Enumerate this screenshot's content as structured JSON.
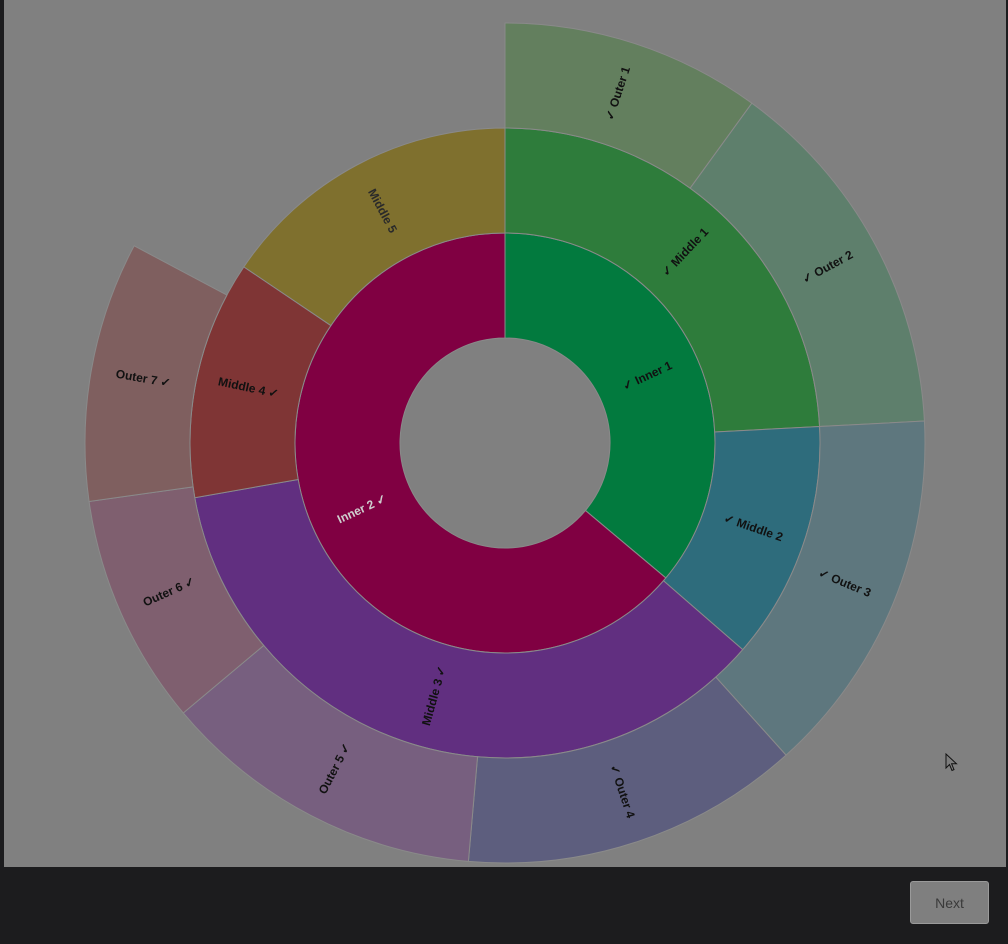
{
  "chart_data": {
    "type": "sunburst",
    "rings": [
      {
        "name": "inner",
        "segments": [
          {
            "label": "✓ Inner 1",
            "start_deg": 0,
            "end_deg": 130,
            "color": "#027a3e",
            "text_color": "#111111"
          },
          {
            "label": "Inner 2 ✓",
            "start_deg": 130,
            "end_deg": 360,
            "color": "#800042",
            "text_color": "#cfcfcf"
          }
        ]
      },
      {
        "name": "middle",
        "segments": [
          {
            "label": "✓ Middle 1",
            "start_deg": 0,
            "end_deg": 87,
            "color": "#2e7c3b",
            "text_color": "#111111"
          },
          {
            "label": "✓ Middle 2",
            "start_deg": 87,
            "end_deg": 131,
            "color": "#2e6c7c",
            "text_color": "#111111"
          },
          {
            "label": "Middle 3 ✓",
            "start_deg": 131,
            "end_deg": 260,
            "color": "#612f80",
            "text_color": "#111111"
          },
          {
            "label": "Middle 4 ✓",
            "start_deg": 260,
            "end_deg": 304,
            "color": "#7f3535",
            "text_color": "#111111"
          },
          {
            "label": "Middle 5",
            "start_deg": 304,
            "end_deg": 360,
            "color": "#7f702e",
            "text_color": "#2a2a2a"
          }
        ]
      },
      {
        "name": "outer",
        "segments": [
          {
            "label": "✓ Outer 1",
            "start_deg": 0,
            "end_deg": 36,
            "color": "#637f5e",
            "text_color": "#111111"
          },
          {
            "label": "✓ Outer 2",
            "start_deg": 36,
            "end_deg": 87,
            "color": "#5e7f6c",
            "text_color": "#111111"
          },
          {
            "label": "✓ Outer 3",
            "start_deg": 87,
            "end_deg": 138,
            "color": "#5e777e",
            "text_color": "#111111"
          },
          {
            "label": "✓ Outer 4",
            "start_deg": 138,
            "end_deg": 185,
            "color": "#5d5e7e",
            "text_color": "#111111"
          },
          {
            "label": "Outer 5 ✓",
            "start_deg": 185,
            "end_deg": 230,
            "color": "#775f7f",
            "text_color": "#111111"
          },
          {
            "label": "Outer 6 ✓",
            "start_deg": 230,
            "end_deg": 262,
            "color": "#7f5f6f",
            "text_color": "#111111"
          },
          {
            "label": "Outer 7 ✓",
            "start_deg": 262,
            "end_deg": 298,
            "color": "#7f5f5f",
            "text_color": "#111111"
          },
          {
            "label": "",
            "start_deg": 298,
            "end_deg": 360,
            "color": "#808080",
            "text_color": "#111111"
          }
        ]
      }
    ]
  },
  "footer": {
    "next_label": "Next"
  },
  "colors": {
    "background": "#808080",
    "footer": "#1c1c1e"
  },
  "icons": {
    "cursor": "mouse-pointer-icon"
  }
}
